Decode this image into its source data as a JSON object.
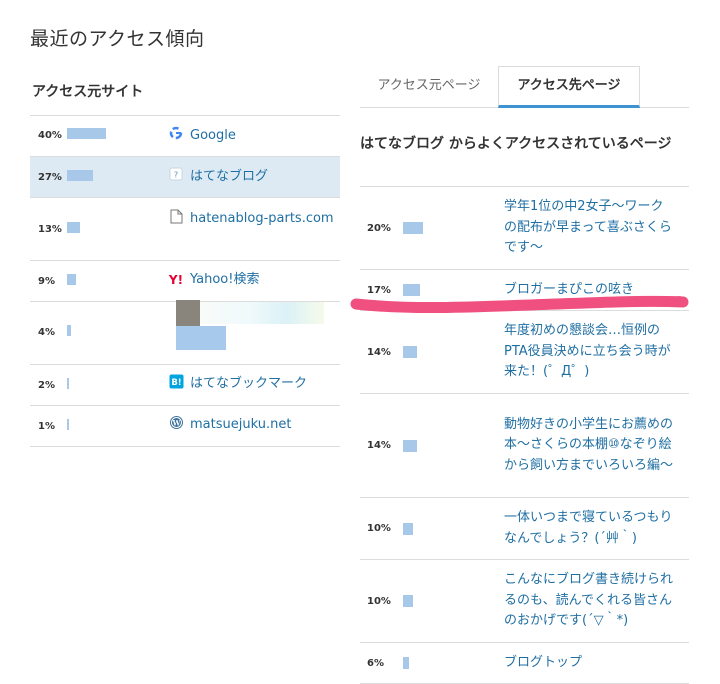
{
  "page_title": "最近のアクセス傾向",
  "referrer_sites": {
    "heading": "アクセス元サイト",
    "rows": [
      {
        "pct": "40%",
        "share": 0.4,
        "icon": "google-icon",
        "label": "Google",
        "selected": false
      },
      {
        "pct": "27%",
        "share": 0.27,
        "icon": "hatena-blog-icon",
        "label": "はてなブログ",
        "selected": true
      },
      {
        "pct": "13%",
        "share": 0.13,
        "icon": "document-icon",
        "label": "hatenablog-parts.com",
        "selected": false
      },
      {
        "pct": "9%",
        "share": 0.09,
        "icon": "yahoo-icon",
        "label": "Yahoo!検索",
        "selected": false
      },
      {
        "pct": "4%",
        "share": 0.04,
        "icon": "redacted-icon",
        "label": "",
        "selected": false
      },
      {
        "pct": "2%",
        "share": 0.02,
        "icon": "hatena-bookmark-icon",
        "label": "はてなブックマーク",
        "selected": false
      },
      {
        "pct": "1%",
        "share": 0.01,
        "icon": "wordpress-icon",
        "label": "matsuejuku.net",
        "selected": false
      }
    ]
  },
  "tabs": [
    {
      "label": "アクセス元ページ",
      "active": false
    },
    {
      "label": "アクセス先ページ",
      "active": true
    }
  ],
  "destination_pages": {
    "heading": "はてなブログ からよくアクセスされているページ",
    "rows": [
      {
        "pct": "20%",
        "share": 0.2,
        "label": "学年1位の中2女子〜ワークの配布が早まって喜ぶさくらです〜"
      },
      {
        "pct": "17%",
        "share": 0.17,
        "label": "ブロガーまぴこの呟き"
      },
      {
        "pct": "14%",
        "share": 0.14,
        "label": "年度初めの懇談会…恒例のPTA役員決めに立ち会う時が来た！(゜Д゜)"
      },
      {
        "pct": "14%",
        "share": 0.14,
        "label": "動物好きの小学生にお薦めの本〜さくらの本棚⑩なぞり絵から飼い方までいろいろ編〜"
      },
      {
        "pct": "10%",
        "share": 0.1,
        "label": "一体いつまで寝ているつもりなんでしょう？(´艸｀)"
      },
      {
        "pct": "10%",
        "share": 0.1,
        "label": "こんなにブログ書き続けられるのも、読んでくれる皆さんのおかげです(´▽｀*)"
      },
      {
        "pct": "6%",
        "share": 0.06,
        "label": "ブログトップ"
      }
    ]
  },
  "colors": {
    "bar": "#a8c8ea",
    "link": "#1f6fa3",
    "selected_row": "#ddeaf3",
    "tab_accent": "#3d93d1",
    "scribble": "#f0507f"
  }
}
